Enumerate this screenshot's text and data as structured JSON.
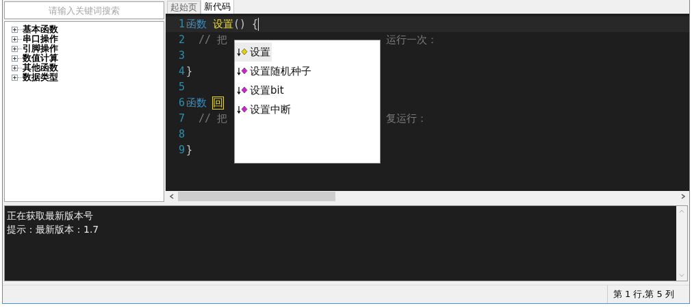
{
  "search": {
    "placeholder": "请输入关键词搜索"
  },
  "tree": [
    {
      "label": "基本函数",
      "expanded": false
    },
    {
      "label": "串口操作",
      "expanded": false
    },
    {
      "label": "引脚操作",
      "expanded": false
    },
    {
      "label": "数值计算",
      "expanded": false
    },
    {
      "label": "其他函数",
      "expanded": false
    },
    {
      "label": "数据类型",
      "expanded": false
    }
  ],
  "tabs": [
    {
      "label": "起始页",
      "selected": false
    },
    {
      "label": "新代码",
      "selected": true
    }
  ],
  "code_lines": [
    {
      "number": "1",
      "tokens": [
        {
          "text": "函数",
          "kind": "keyword"
        },
        {
          "text": "设置",
          "kind": "name"
        },
        {
          "text": "() {",
          "kind": "plain"
        }
      ],
      "current": true
    },
    {
      "number": "2",
      "tokens": [
        {
          "text": "// 把",
          "kind": "comment"
        }
      ],
      "after": "运行一次：",
      "current": false
    },
    {
      "number": "3",
      "current": false
    },
    {
      "number": "4",
      "tokens": [
        {
          "text": "}",
          "kind": "plain"
        }
      ],
      "current": false
    },
    {
      "number": "5",
      "current": false
    },
    {
      "number": "6",
      "tokens": [
        {
          "text": "函数",
          "kind": "keyword"
        },
        {
          "text": "回",
          "kind": "boxed"
        }
      ],
      "current": false
    },
    {
      "number": "7",
      "tokens": [
        {
          "text": "// 把",
          "kind": "comment"
        }
      ],
      "after": "复运行：",
      "current": false
    },
    {
      "number": "8",
      "current": false
    },
    {
      "number": "9",
      "tokens": [
        {
          "text": "}",
          "kind": "plain"
        }
      ],
      "current": false
    }
  ],
  "completion": [
    {
      "label": "设置",
      "selected": true,
      "color": "#e6d200"
    },
    {
      "label": "设置随机种子",
      "selected": false,
      "color": "#d020d0"
    },
    {
      "label": "设置bit",
      "selected": false,
      "color": "#d020d0"
    },
    {
      "label": "设置中断",
      "selected": false,
      "color": "#d020d0"
    }
  ],
  "output": [
    "正在获取最新版本号",
    "提示：最新版本：1.7"
  ],
  "status_bar": {
    "position": "第 1 行,第 5 列"
  }
}
